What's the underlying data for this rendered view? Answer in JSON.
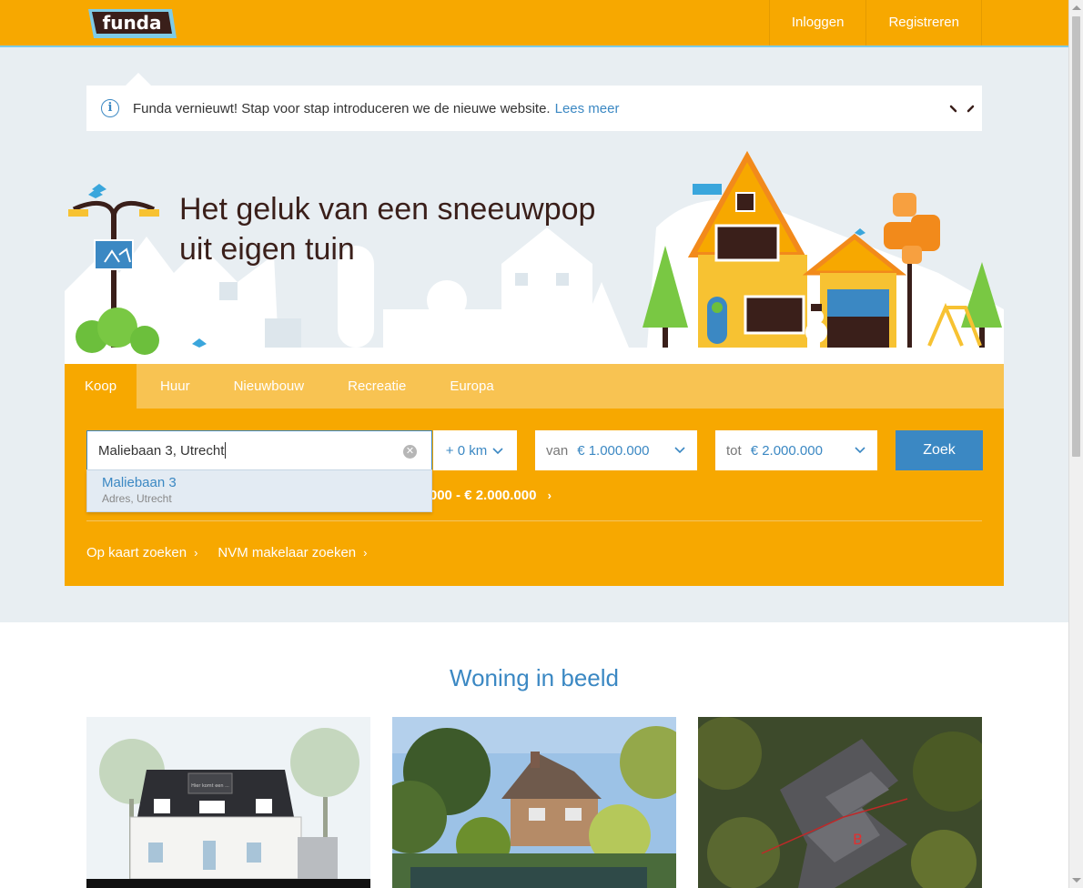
{
  "header": {
    "logo_text": "funda",
    "nav": [
      {
        "label": "Inloggen"
      },
      {
        "label": "Registreren"
      }
    ]
  },
  "notice": {
    "icon": "i",
    "text": "Funda vernieuwt! Stap voor stap introduceren we de nieuwe website.",
    "link": "Lees meer"
  },
  "hero": {
    "title_line1": "Het geluk van een sneeuwpop",
    "title_line2": "uit eigen tuin"
  },
  "search": {
    "tabs": [
      {
        "label": "Koop",
        "active": true
      },
      {
        "label": "Huur"
      },
      {
        "label": "Nieuwbouw"
      },
      {
        "label": "Recreatie"
      },
      {
        "label": "Europa"
      }
    ],
    "location_value": "Maliebaan 3, Utrecht",
    "radius": "+ 0 km",
    "price_from_label": "van",
    "price_from_value": "€ 1.000.000",
    "price_to_label": "tot",
    "price_to_value": "€ 2.000.000",
    "submit": "Zoek",
    "suggestion": {
      "title": "Maliebaan 3",
      "subtitle": "Adres, Utrecht"
    },
    "last_search": "00.000 - € 2.000.000",
    "links": [
      {
        "label": "Op kaart zoeken"
      },
      {
        "label": "NVM makelaar zoeken"
      }
    ]
  },
  "content": {
    "title": "Woning in beeld",
    "card1_sign": "Hier komt een ..."
  },
  "colors": {
    "brand_orange": "#f7a800",
    "brand_blue": "#3b88c3",
    "hero_bg": "#e8eef2"
  }
}
